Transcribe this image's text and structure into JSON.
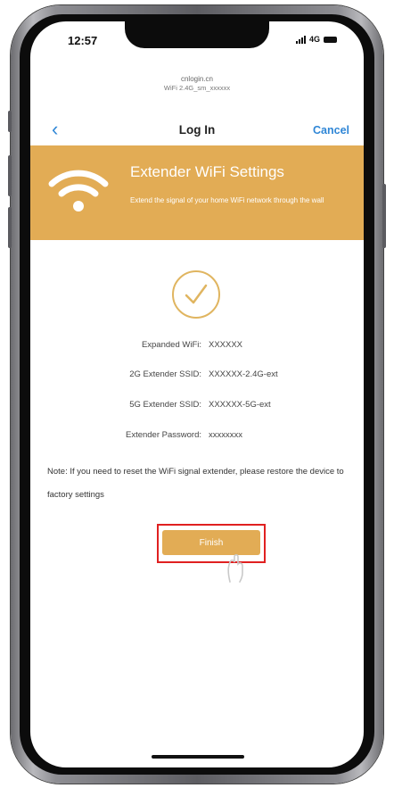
{
  "status_bar": {
    "time": "12:57",
    "network": "4G"
  },
  "browser": {
    "url_domain": "cnlogin.cn",
    "url_ssid": "WiFi 2.4G_sm_xxxxxx"
  },
  "nav": {
    "back_icon": "chevron-left-icon",
    "title": "Log In",
    "cancel_label": "Cancel"
  },
  "banner": {
    "icon": "wifi-icon",
    "title": "Extender WiFi Settings",
    "description": "Extend the signal of your home WiFi network through the wall"
  },
  "status_icon": "check-circle-icon",
  "info": {
    "expanded_wifi_label": "Expanded WiFi:",
    "expanded_wifi_value": "XXXXXX",
    "ssid_2g_label": "2G Extender SSID:",
    "ssid_2g_value": "XXXXXX-2.4G-ext",
    "ssid_5g_label": "5G Extender SSID:",
    "ssid_5g_value": "XXXXXX-5G-ext",
    "password_label": "Extender Password:",
    "password_value": "xxxxxxxx"
  },
  "note": "Note: If you need to reset the WiFi signal extender, please restore the device to factory settings",
  "finish_label": "Finish",
  "colors": {
    "accent": "#e2ac55",
    "link": "#2f86d6",
    "highlight": "#e02020"
  }
}
